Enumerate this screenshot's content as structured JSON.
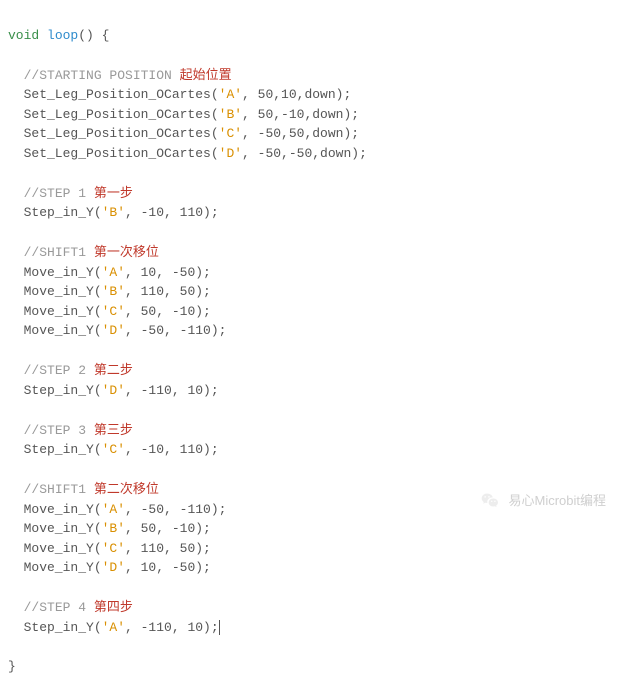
{
  "code": {
    "kw_void": "void",
    "kw_func": "loop",
    "open": "() {",
    "comments": {
      "start_en": "//STARTING POSITION ",
      "start_cn": "起始位置",
      "step1_en": "//STEP 1 ",
      "step1_cn": "第一步",
      "shift1_en": "//SHIFT1 ",
      "shift1_cn": "第一次移位",
      "step2_en": "//STEP 2 ",
      "step2_cn": "第二步",
      "step3_en": "//STEP 3 ",
      "step3_cn": "第三步",
      "shift2_en": "//SHIFT1 ",
      "shift2_cn": "第二次移位",
      "step4_en": "//STEP 4 ",
      "step4_cn": "第四步"
    },
    "lines": {
      "spA": {
        "pre": "  Set_Leg_Position_OCartes(",
        "ch": "'A'",
        "post": ", 50,10,down);"
      },
      "spB": {
        "pre": "  Set_Leg_Position_OCartes(",
        "ch": "'B'",
        "post": ", 50,-10,down);"
      },
      "spC": {
        "pre": "  Set_Leg_Position_OCartes(",
        "ch": "'C'",
        "post": ", -50,50,down);"
      },
      "spD": {
        "pre": "  Set_Leg_Position_OCartes(",
        "ch": "'D'",
        "post": ", -50,-50,down);"
      },
      "s1": {
        "pre": "  Step_in_Y(",
        "ch": "'B'",
        "post": ", -10, 110);"
      },
      "m1a": {
        "pre": "  Move_in_Y(",
        "ch": "'A'",
        "post": ", 10, -50);"
      },
      "m1b": {
        "pre": "  Move_in_Y(",
        "ch": "'B'",
        "post": ", 110, 50);"
      },
      "m1c": {
        "pre": "  Move_in_Y(",
        "ch": "'C'",
        "post": ", 50, -10);"
      },
      "m1d": {
        "pre": "  Move_in_Y(",
        "ch": "'D'",
        "post": ", -50, -110);"
      },
      "s2": {
        "pre": "  Step_in_Y(",
        "ch": "'D'",
        "post": ", -110, 10);"
      },
      "s3": {
        "pre": "  Step_in_Y(",
        "ch": "'C'",
        "post": ", -10, 110);"
      },
      "m2a": {
        "pre": "  Move_in_Y(",
        "ch": "'A'",
        "post": ", -50, -110);"
      },
      "m2b": {
        "pre": "  Move_in_Y(",
        "ch": "'B'",
        "post": ", 50, -10);"
      },
      "m2c": {
        "pre": "  Move_in_Y(",
        "ch": "'C'",
        "post": ", 110, 50);"
      },
      "m2d": {
        "pre": "  Move_in_Y(",
        "ch": "'D'",
        "post": ", 10, -50);"
      },
      "s4": {
        "pre": "  Step_in_Y(",
        "ch": "'A'",
        "post": ", -110, 10);"
      }
    },
    "close": "}"
  },
  "footer": {
    "icon": "wechat-icon",
    "text": "易心Microbit编程"
  }
}
